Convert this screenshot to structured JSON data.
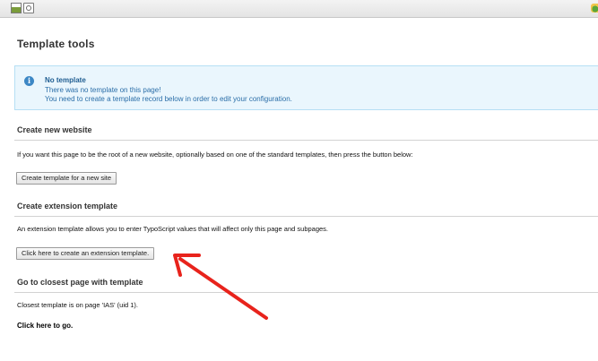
{
  "page": {
    "title": "Template tools"
  },
  "notice": {
    "title": "No template",
    "line1": "There was no template on this page!",
    "line2": "You need to create a template record below in order to edit your configuration."
  },
  "sections": {
    "new_website": {
      "heading": "Create new website",
      "text": "If you want this page to be the root of a new website, optionally based on one of the standard templates, then press the button below:",
      "button": "Create template for a new site"
    },
    "extension": {
      "heading": "Create extension template",
      "text": "An extension template allows you to enter TypoScript values that will affect only this page and subpages.",
      "button": "Click here to create an extension template."
    },
    "closest": {
      "heading": "Go to closest page with template",
      "text": "Closest template is on page 'IAS' (uid 1).",
      "link": "Click here to go."
    }
  },
  "toolbar": {
    "icons": [
      "template-record-icon",
      "view-page-icon",
      "shortcut-icon"
    ]
  },
  "annotation": {
    "arrow_color": "#e8231c"
  }
}
